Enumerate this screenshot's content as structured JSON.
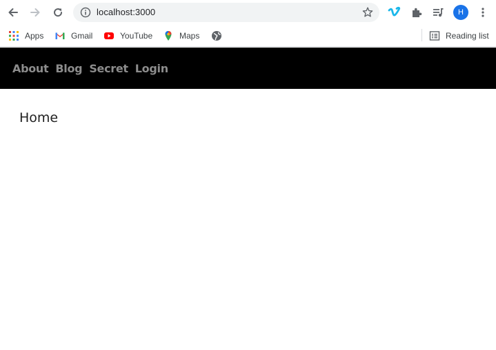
{
  "browser": {
    "url": "localhost:3000",
    "profile_initial": "H",
    "bookmarks": [
      "Apps",
      "Gmail",
      "YouTube",
      "Maps"
    ],
    "reading_list": "Reading list"
  },
  "site_nav": {
    "links": [
      "About",
      "Blog",
      "Secret",
      "Login"
    ]
  },
  "main": {
    "title": "Home"
  }
}
